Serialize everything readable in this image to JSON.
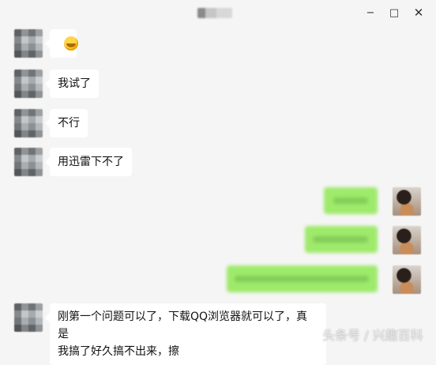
{
  "window": {
    "controls": {
      "minimize": "−",
      "maximize": "□",
      "close": "✕"
    }
  },
  "messages": [
    {
      "from": "other",
      "text": "",
      "icon": "laughing-emoji-icon"
    },
    {
      "from": "other",
      "text": "我试了"
    },
    {
      "from": "other",
      "text": "不行"
    },
    {
      "from": "other",
      "text": "用迅雷下不了"
    },
    {
      "from": "self",
      "text": ""
    },
    {
      "from": "self",
      "text": ""
    },
    {
      "from": "self",
      "text": ""
    },
    {
      "from": "other",
      "text_line1": "刚第一个问题可以了，下载QQ浏览器就可以了，真是",
      "text_line2": "我搞了好久搞不出来，擦"
    }
  ],
  "watermark": "头条号 / 兴趣百科",
  "colors": {
    "self_bubble": "#9eea6a",
    "other_bubble": "#ffffff",
    "background": "#f5f5f5"
  }
}
